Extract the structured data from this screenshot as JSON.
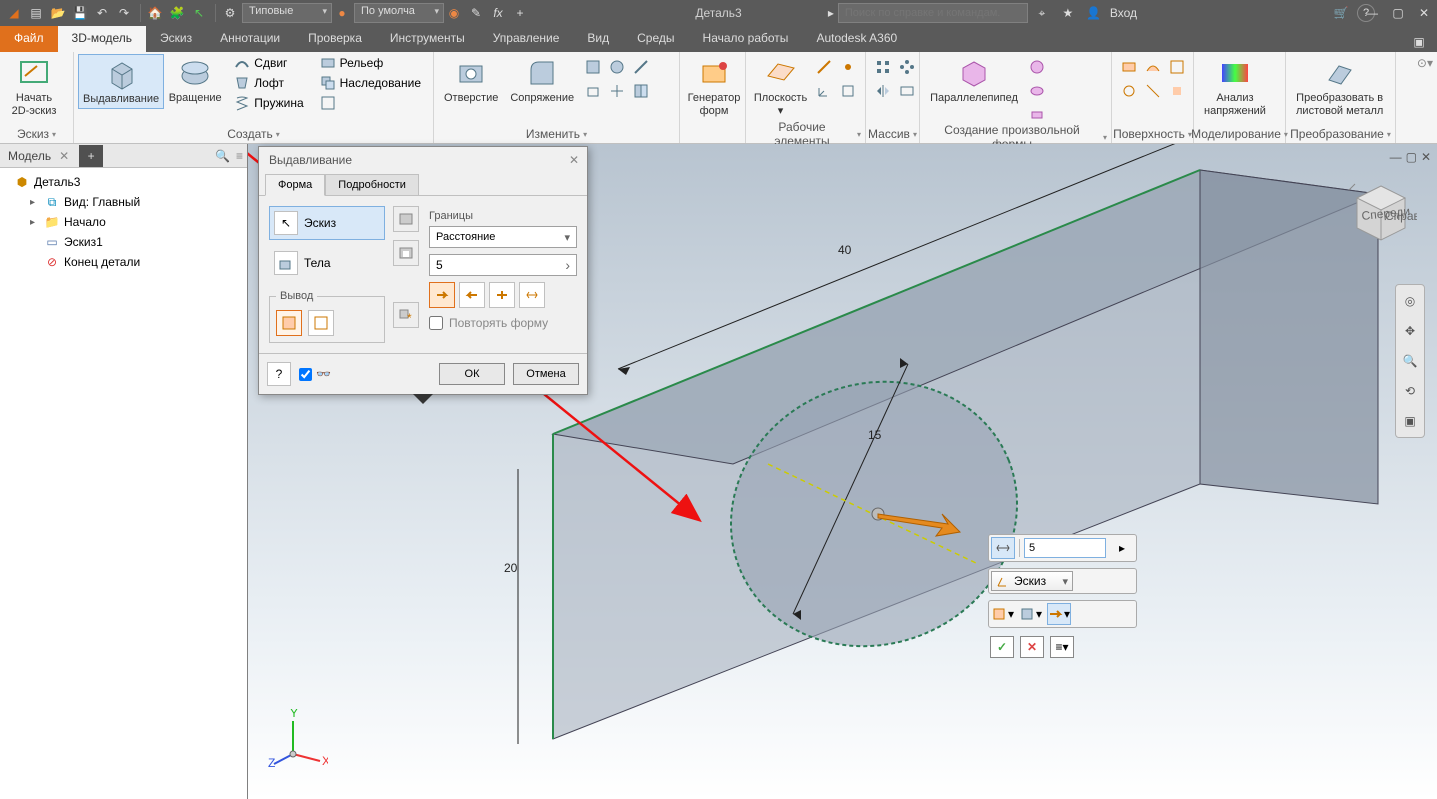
{
  "title_bar": {
    "doc_title": "Деталь3",
    "style_combo": "Типовые",
    "appearance_combo": "По умолча",
    "search_placeholder": "Поиск по справке и командам.",
    "user": "Вход",
    "help_symbol": "?"
  },
  "tabs": {
    "file": "Файл",
    "list": [
      "3D-модель",
      "Эскиз",
      "Аннотации",
      "Проверка",
      "Инструменты",
      "Управление",
      "Вид",
      "Среды",
      "Начало работы",
      "Autodesk A360"
    ],
    "active": "3D-модель"
  },
  "ribbon": {
    "panels": [
      {
        "label": "Эскиз",
        "label_no_arrow": true,
        "big": [
          {
            "k": "sketch",
            "lines": [
              "Начать",
              "2D-эскиз"
            ]
          }
        ]
      },
      {
        "label": "Создать",
        "big": [
          {
            "k": "extrude",
            "lines": [
              "Выдавливание"
            ],
            "hl": true
          },
          {
            "k": "revolve",
            "lines": [
              "Вращение"
            ]
          }
        ],
        "small": [
          {
            "k": "sweep",
            "t": "Сдвиг"
          },
          {
            "k": "loft",
            "t": "Лофт"
          },
          {
            "k": "coil",
            "t": "Пружина"
          },
          {
            "k": "emboss",
            "t": "Рельеф"
          },
          {
            "k": "derive",
            "t": "Наследование"
          },
          {
            "k": "more",
            "t": ""
          }
        ]
      },
      {
        "label": "Изменить",
        "big": [
          {
            "k": "hole",
            "lines": [
              "Отверстие"
            ]
          },
          {
            "k": "fillet",
            "lines": [
              "Сопряжение"
            ]
          }
        ],
        "grid": 6
      },
      {
        "label": "",
        "label_hidden": true,
        "big": [
          {
            "k": "shapegen",
            "lines": [
              "Генератор",
              "форм"
            ]
          }
        ]
      },
      {
        "label": "Рабочие элементы",
        "big": [
          {
            "k": "plane",
            "lines": [
              "Плоскость",
              ""
            ]
          }
        ],
        "grid": 6
      },
      {
        "label": "Массив",
        "grid": 6
      },
      {
        "label": "Создание произвольной формы",
        "big": [
          {
            "k": "box",
            "lines": [
              "Параллелепипед"
            ]
          }
        ],
        "grid": 3
      },
      {
        "label": "Поверхность",
        "grid": 6
      },
      {
        "label": "Моделирование",
        "big": [
          {
            "k": "stress",
            "lines": [
              "Анализ",
              "напряжений"
            ]
          }
        ]
      },
      {
        "label": "Преобразование",
        "big": [
          {
            "k": "sheet",
            "lines": [
              "Преобразовать в",
              "листовой металл"
            ]
          }
        ]
      }
    ]
  },
  "browser": {
    "title": "Модель",
    "root": "Деталь3",
    "items": [
      {
        "icon": "view",
        "t": "Вид: Главный",
        "exp": true
      },
      {
        "icon": "folder",
        "t": "Начало",
        "exp": true
      },
      {
        "icon": "sketch",
        "t": "Эскиз1",
        "exp": false
      },
      {
        "icon": "end",
        "t": "Конец детали",
        "exp": false
      }
    ]
  },
  "dialog": {
    "title": "Выдавливание",
    "tabs": [
      "Форма",
      "Подробности"
    ],
    "active_tab": "Форма",
    "sketch_label": "Эскиз",
    "solids_label": "Тела",
    "output_label": "Вывод",
    "extents_label": "Границы",
    "extents_combo": "Расстояние",
    "distance_value": "5",
    "repeat_label": "Повторять форму",
    "ok": "ОК",
    "cancel": "Отмена"
  },
  "viewport": {
    "dim_width": "40",
    "dim_height": "20",
    "dim_diameter": "15",
    "mini_distance": "5",
    "mini_profile": "Эскиз",
    "cube_front": "Спереди",
    "cube_right": "Справа"
  },
  "triad": {
    "x": "X",
    "y": "Y",
    "z": "Z"
  }
}
